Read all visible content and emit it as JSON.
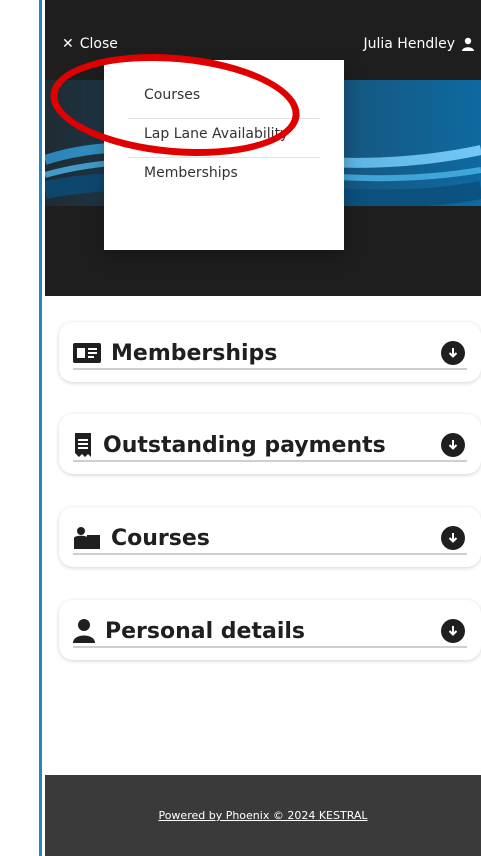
{
  "header": {
    "close_label": "Close",
    "user_name": "Julia Hendley"
  },
  "menu": {
    "items": [
      {
        "label": "Courses"
      },
      {
        "label": "Lap Lane Availability"
      },
      {
        "label": "Memberships"
      }
    ]
  },
  "cards": [
    {
      "title": "Memberships",
      "icon": "id-card-icon"
    },
    {
      "title": "Outstanding payments",
      "icon": "receipt-icon"
    },
    {
      "title": "Courses",
      "icon": "teacher-icon"
    },
    {
      "title": "Personal details",
      "icon": "user-icon"
    }
  ],
  "footer": {
    "text": "Powered by Phoenix © 2024 KESTRAL"
  },
  "colors": {
    "header_bg": "#1e1e1e",
    "accent_blue": "#1e88c7",
    "annotation_red": "#e00000",
    "footer_bg": "#3a3a3a"
  }
}
